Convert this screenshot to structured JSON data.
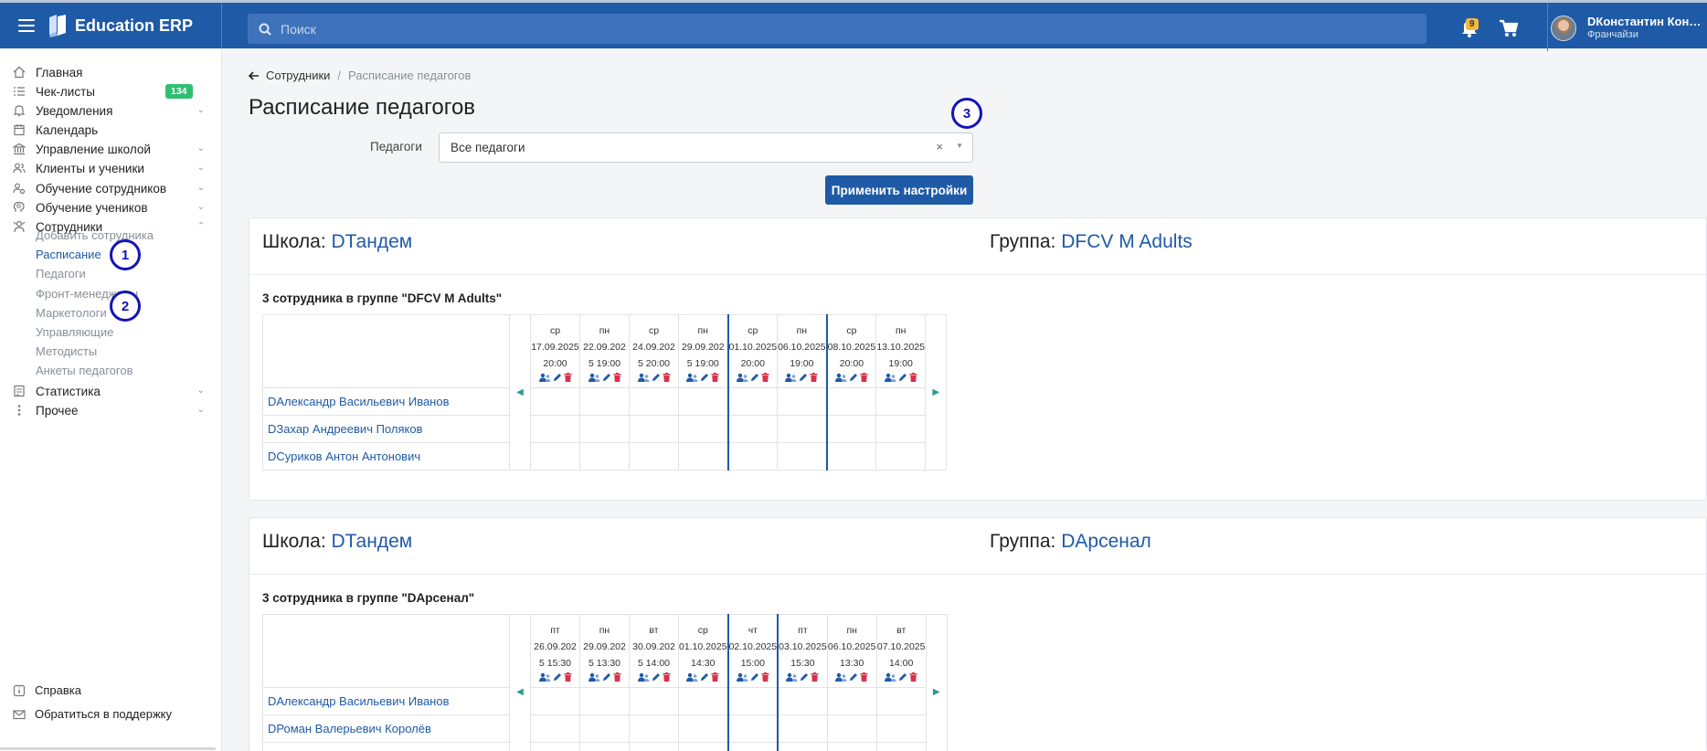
{
  "app": {
    "brand": "Education ERP"
  },
  "search": {
    "placeholder": "Поиск"
  },
  "notifications": {
    "count": "9"
  },
  "user": {
    "name": "DКонстантин Кон…",
    "role": "Франчайзи"
  },
  "sidebar": {
    "items": [
      {
        "label": "Главная",
        "icon": "home-icon"
      },
      {
        "label": "Чек-листы",
        "icon": "list-icon",
        "badge": "134"
      },
      {
        "label": "Уведомления",
        "icon": "bell-icon"
      },
      {
        "label": "Календарь",
        "icon": "calendar-icon"
      },
      {
        "label": "Управление школой",
        "icon": "bank-icon"
      },
      {
        "label": "Клиенты и ученики",
        "icon": "users-icon"
      },
      {
        "label": "Обучение сотрудников",
        "icon": "user-gear-icon"
      },
      {
        "label": "Обучение учеников",
        "icon": "brain-icon"
      },
      {
        "label": "Сотрудники",
        "icon": "staff-icon"
      },
      {
        "label": "Статистика",
        "icon": "stats-icon"
      },
      {
        "label": "Прочее",
        "icon": "more-icon"
      }
    ],
    "subitems": [
      "Добавить сотрудника",
      "Расписание",
      "Педагоги",
      "Фронт-менеджеры",
      "Маркетологи",
      "Управляющие",
      "Методисты",
      "Анкеты педагогов"
    ],
    "footer": [
      {
        "label": "Справка",
        "icon": "info-icon"
      },
      {
        "label": "Обратиться в поддержку",
        "icon": "mail-icon"
      }
    ]
  },
  "markers": [
    "1",
    "2",
    "3"
  ],
  "breadcrumb": {
    "parent": "Сотрудники",
    "separator": "/",
    "current": "Расписание педагогов"
  },
  "page": {
    "title": "Расписание педагогов"
  },
  "filter": {
    "label": "Педагоги",
    "value": "Все педагоги",
    "clear": "×",
    "apply": "Применить настройки"
  },
  "schedules": [
    {
      "school_label": "Школа:",
      "school": "DТандем",
      "group_label": "Группа:",
      "group": "DFCV M Adults",
      "staff_count": "3 сотрудника в группе \"DFCV M Adults\"",
      "days": [
        {
          "dow": "ср",
          "date": "17.09.2025",
          "time": "20:00"
        },
        {
          "dow": "пн",
          "date": "22.09.202",
          "time": "5 19:00"
        },
        {
          "dow": "ср",
          "date": "24.09.202",
          "time": "5 20:00"
        },
        {
          "dow": "пн",
          "date": "29.09.202",
          "time": "5 19:00"
        },
        {
          "dow": "ср",
          "date": "01.10.2025",
          "time": "20:00"
        },
        {
          "dow": "пн",
          "date": "06.10.2025",
          "time": "19:00"
        },
        {
          "dow": "ср",
          "date": "08.10.2025",
          "time": "20:00"
        },
        {
          "dow": "пн",
          "date": "13.10.2025",
          "time": "19:00"
        }
      ],
      "staff": [
        "DАлександр Васильевич Иванов",
        "DЗахар Андреевич Поляков",
        "DСуриков Антон Антонович"
      ]
    },
    {
      "school_label": "Школа:",
      "school": "DТандем",
      "group_label": "Группа:",
      "group": "DАрсенал",
      "staff_count": "3 сотрудника в группе \"DАрсенал\"",
      "days": [
        {
          "dow": "пт",
          "date": "26.09.202",
          "time": "5 15:30"
        },
        {
          "dow": "пн",
          "date": "29.09.202",
          "time": "5 13:30"
        },
        {
          "dow": "вт",
          "date": "30.09.202",
          "time": "5 14:00"
        },
        {
          "dow": "ср",
          "date": "01.10.2025",
          "time": "14:30"
        },
        {
          "dow": "чт",
          "date": "02.10.2025",
          "time": "15:00"
        },
        {
          "dow": "пт",
          "date": "03.10.2025",
          "time": "15:30"
        },
        {
          "dow": "пн",
          "date": "06.10.2025",
          "time": "13:30"
        },
        {
          "dow": "вт",
          "date": "07.10.2025",
          "time": "14:00"
        }
      ],
      "staff": [
        "DАлександр Васильевич Иванов",
        "DРоман Валерьевич Королёв"
      ]
    }
  ],
  "colors": {
    "primary": "#1f5aa6",
    "accent_green": "#2fbf71",
    "badge_yellow": "#f5b841",
    "delete_red": "#d9314a",
    "marker_blue": "#1414b8"
  }
}
